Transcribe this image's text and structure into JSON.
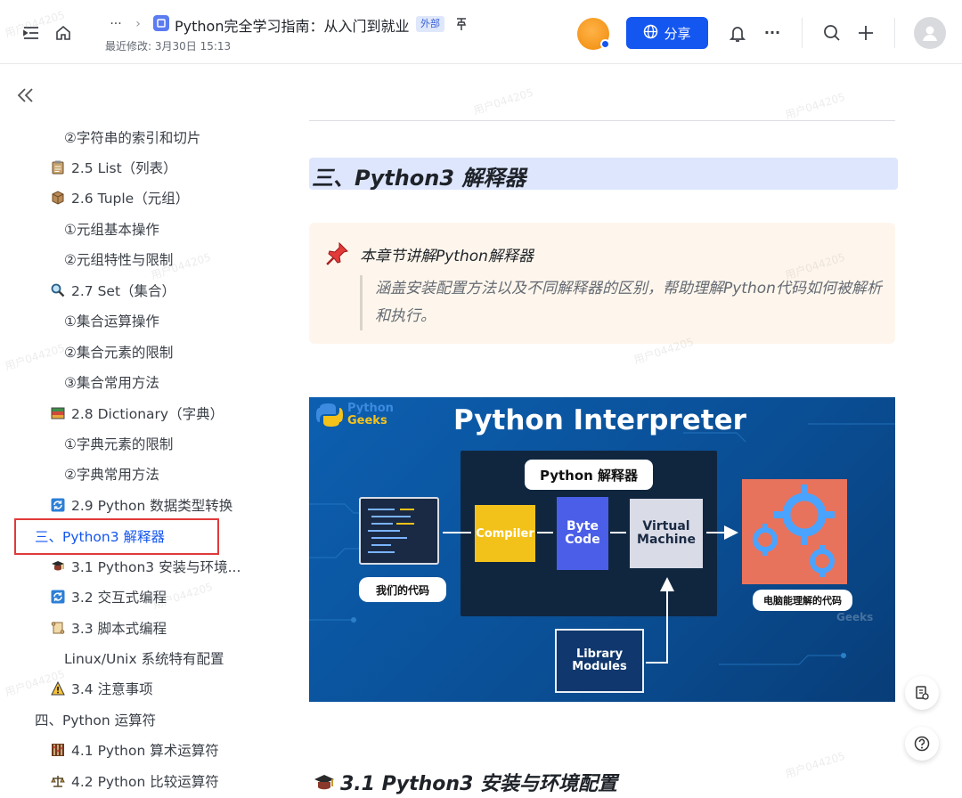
{
  "header": {
    "breadcrumb_more": "···",
    "doc_title": "Python完全学习指南：从入门到就业",
    "external_badge": "外部",
    "last_modified": "最近修改: 3月30日 15:13",
    "share_label": "分享",
    "more": "···"
  },
  "sidebar": {
    "collapse": "《",
    "items": [
      {
        "label": "②字符串的索引和切片",
        "icon": ""
      },
      {
        "label": "2.5 List（列表）",
        "icon": "clipboard-icon"
      },
      {
        "label": "2.6 Tuple（元组）",
        "icon": "box-icon"
      },
      {
        "label": "①元组基本操作",
        "icon": ""
      },
      {
        "label": "②元组特性与限制",
        "icon": ""
      },
      {
        "label": "2.7 Set（集合）",
        "icon": "magnifier-icon"
      },
      {
        "label": "①集合运算操作",
        "icon": ""
      },
      {
        "label": "②集合元素的限制",
        "icon": ""
      },
      {
        "label": "③集合常用方法",
        "icon": ""
      },
      {
        "label": "2.8 Dictionary（字典）",
        "icon": "books-icon"
      },
      {
        "label": "①字典元素的限制",
        "icon": ""
      },
      {
        "label": "②字典常用方法",
        "icon": ""
      },
      {
        "label": "2.9 Python 数据类型转换",
        "icon": "refresh-icon"
      },
      {
        "label": "三、Python3 解释器",
        "icon": ""
      },
      {
        "label": "3.1 Python3 安装与环境...",
        "icon": "mortarboard-icon"
      },
      {
        "label": "3.2 交互式编程",
        "icon": "refresh-icon"
      },
      {
        "label": "3.3 脚本式编程",
        "icon": "scroll-icon"
      },
      {
        "label": "Linux/Unix 系统特有配置",
        "icon": ""
      },
      {
        "label": "3.4 注意事项",
        "icon": "warning-icon"
      },
      {
        "label": "四、Python 运算符",
        "icon": ""
      },
      {
        "label": "4.1 Python 算术运算符",
        "icon": "abacus-icon"
      },
      {
        "label": "4.2 Python 比较运算符",
        "icon": "scales-icon"
      }
    ]
  },
  "content": {
    "section_heading": "三、Python3 解释器",
    "callout_title": "本章节讲解Python解释器",
    "callout_body": "涵盖安装配置方法以及不同解释器的区别，帮助理解Python代码如何被解析和执行。",
    "subsection_heading": "3.1 Python3 安装与环境配置",
    "figure": {
      "brand_line1": "Python",
      "brand_line2": "Geeks",
      "title": "Python Interpreter",
      "interpreter_label": "Python 解释器",
      "input_label": "我们的代码",
      "compiler": "Compiler",
      "byte_code_1": "Byte",
      "byte_code_2": "Code",
      "vm_1": "Virtual",
      "vm_2": "Machine",
      "library_1": "Library",
      "library_2": "Modules",
      "output_label": "电脑能理解的代码",
      "watermark_brand": "Geeks"
    }
  },
  "watermark": "用户044205",
  "colors": {
    "accent": "#1456f0",
    "heading_highlight": "#dde6fc",
    "callout_bg": "#fef6ec",
    "toc_active": "#1456f0",
    "highlight_box": "#e03a3a",
    "compiler_box": "#f2c21b",
    "bytecode_box": "#4a5ee8",
    "vm_box": "#d9dbe6",
    "output_box": "#e8735c"
  }
}
